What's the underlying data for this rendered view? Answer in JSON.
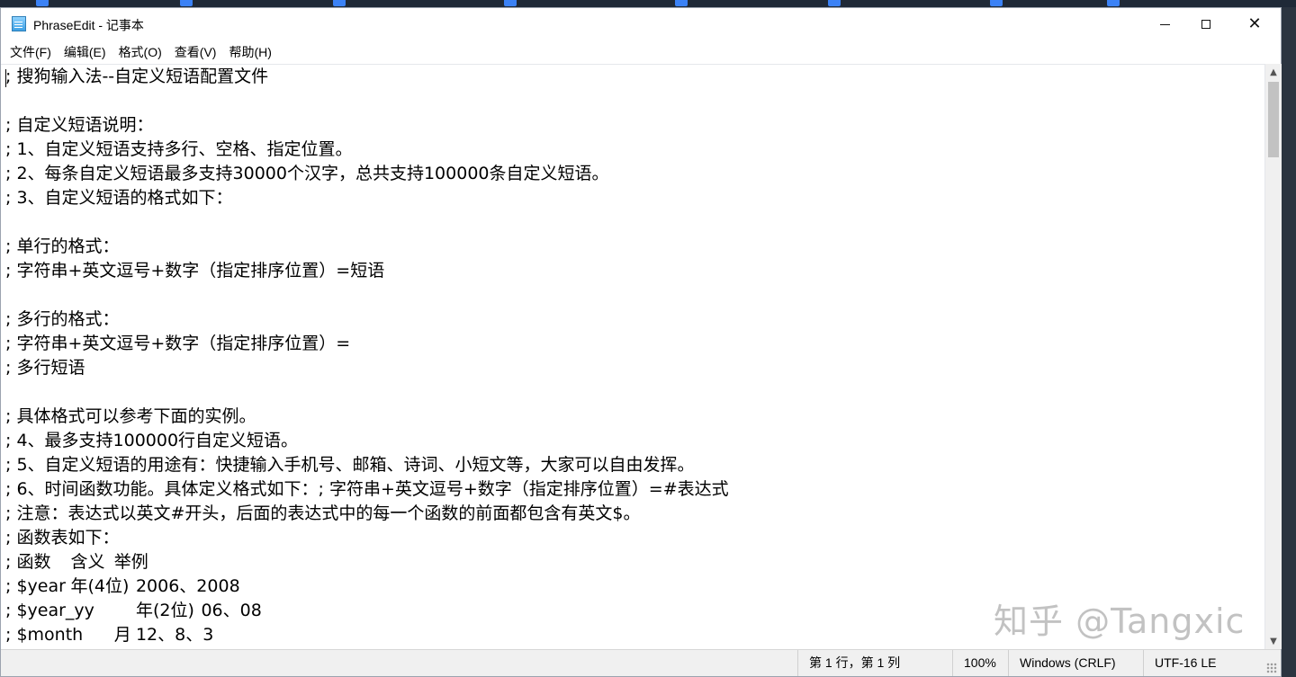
{
  "window": {
    "title": "PhraseEdit - 记事本"
  },
  "menu": {
    "items": [
      "文件(F)",
      "编辑(E)",
      "格式(O)",
      "查看(V)",
      "帮助(H)"
    ]
  },
  "editor": {
    "lines": [
      "; 搜狗输入法--自定义短语配置文件",
      "",
      "; 自定义短语说明：",
      "; 1、自定义短语支持多行、空格、指定位置。",
      "; 2、每条自定义短语最多支持30000个汉字，总共支持100000条自定义短语。",
      "; 3、自定义短语的格式如下：",
      "",
      "; 单行的格式：",
      "; 字符串+英文逗号+数字（指定排序位置）=短语",
      "",
      "; 多行的格式：",
      "; 字符串+英文逗号+数字（指定排序位置）=",
      "; 多行短语",
      "",
      "; 具体格式可以参考下面的实例。",
      "; 4、最多支持100000行自定义短语。",
      "; 5、自定义短语的用途有：快捷输入手机号、邮箱、诗词、小短文等，大家可以自由发挥。",
      "; 6、时间函数功能。具体定义格式如下：; 字符串+英文逗号+数字（指定排序位置）=#表达式",
      "; 注意：表达式以英文#开头，后面的表达式中的每一个函数的前面都包含有英文$。",
      "; 函数表如下：",
      "; 函数\t含义\t举例",
      "; $year\t年(4位)\t2006、2008",
      "; $year_yy\t\t年(2位)\t06、08",
      "; $month\t\t月\t12、8、3"
    ]
  },
  "statusbar": {
    "position": "第 1 行，第 1 列",
    "zoom": "100%",
    "line_ending": "Windows (CRLF)",
    "encoding": "UTF-16 LE"
  },
  "watermark": {
    "text": "知乎 @Tangxic"
  },
  "icons": {
    "app": "notepad-icon",
    "minimize": "minimize-icon",
    "maximize": "maximize-icon",
    "close": "close-icon"
  }
}
